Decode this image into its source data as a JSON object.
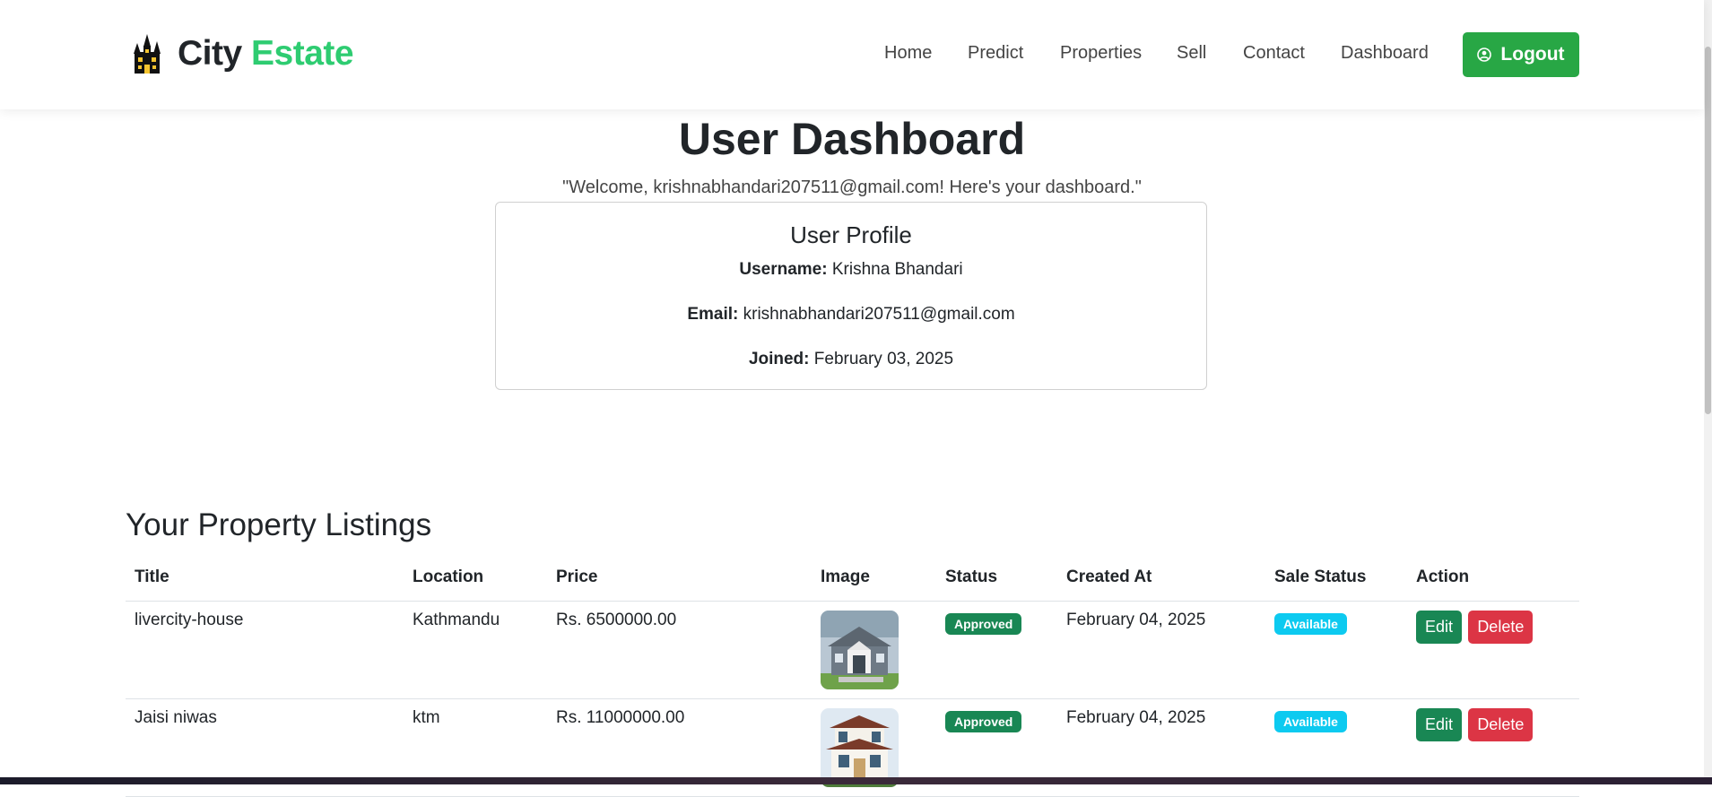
{
  "brand": {
    "city": "City",
    "estate": "Estate",
    "icon": "haunted-house-icon"
  },
  "nav": {
    "items": [
      {
        "label": "Home"
      },
      {
        "label": "Predict"
      },
      {
        "label": "Properties"
      },
      {
        "label": "Sell"
      },
      {
        "label": "Contact"
      },
      {
        "label": "Dashboard"
      }
    ],
    "logout_label": "Logout",
    "logout_icon": "user-circle-icon"
  },
  "dashboard": {
    "title": "User Dashboard",
    "welcome": "\"Welcome, krishnabhandari207511@gmail.com! Here's your dashboard.\""
  },
  "profile": {
    "heading": "User Profile",
    "username_label": "Username:",
    "username": "Krishna Bhandari",
    "email_label": "Email:",
    "email": "krishnabhandari207511@gmail.com",
    "joined_label": "Joined:",
    "joined": "February 03, 2025"
  },
  "listings": {
    "heading": "Your Property Listings",
    "columns": [
      "Title",
      "Location",
      "Price",
      "Image",
      "Status",
      "Created At",
      "Sale Status",
      "Action"
    ],
    "rows": [
      {
        "title": "livercity-house",
        "location": "Kathmandu",
        "price": "Rs. 6500000.00",
        "status": "Approved",
        "created_at": "February 04, 2025",
        "sale_status": "Available",
        "edit": "Edit",
        "delete": "Delete"
      },
      {
        "title": "Jaisi niwas",
        "location": "ktm",
        "price": "Rs. 11000000.00",
        "status": "Approved",
        "created_at": "February 04, 2025",
        "sale_status": "Available",
        "edit": "Edit",
        "delete": "Delete"
      }
    ]
  },
  "colors": {
    "brand_green": "#2ecc71",
    "logout_green": "#28a745",
    "approved_badge": "#198754",
    "available_badge": "#0dcaf0",
    "delete_red": "#dc3545"
  }
}
